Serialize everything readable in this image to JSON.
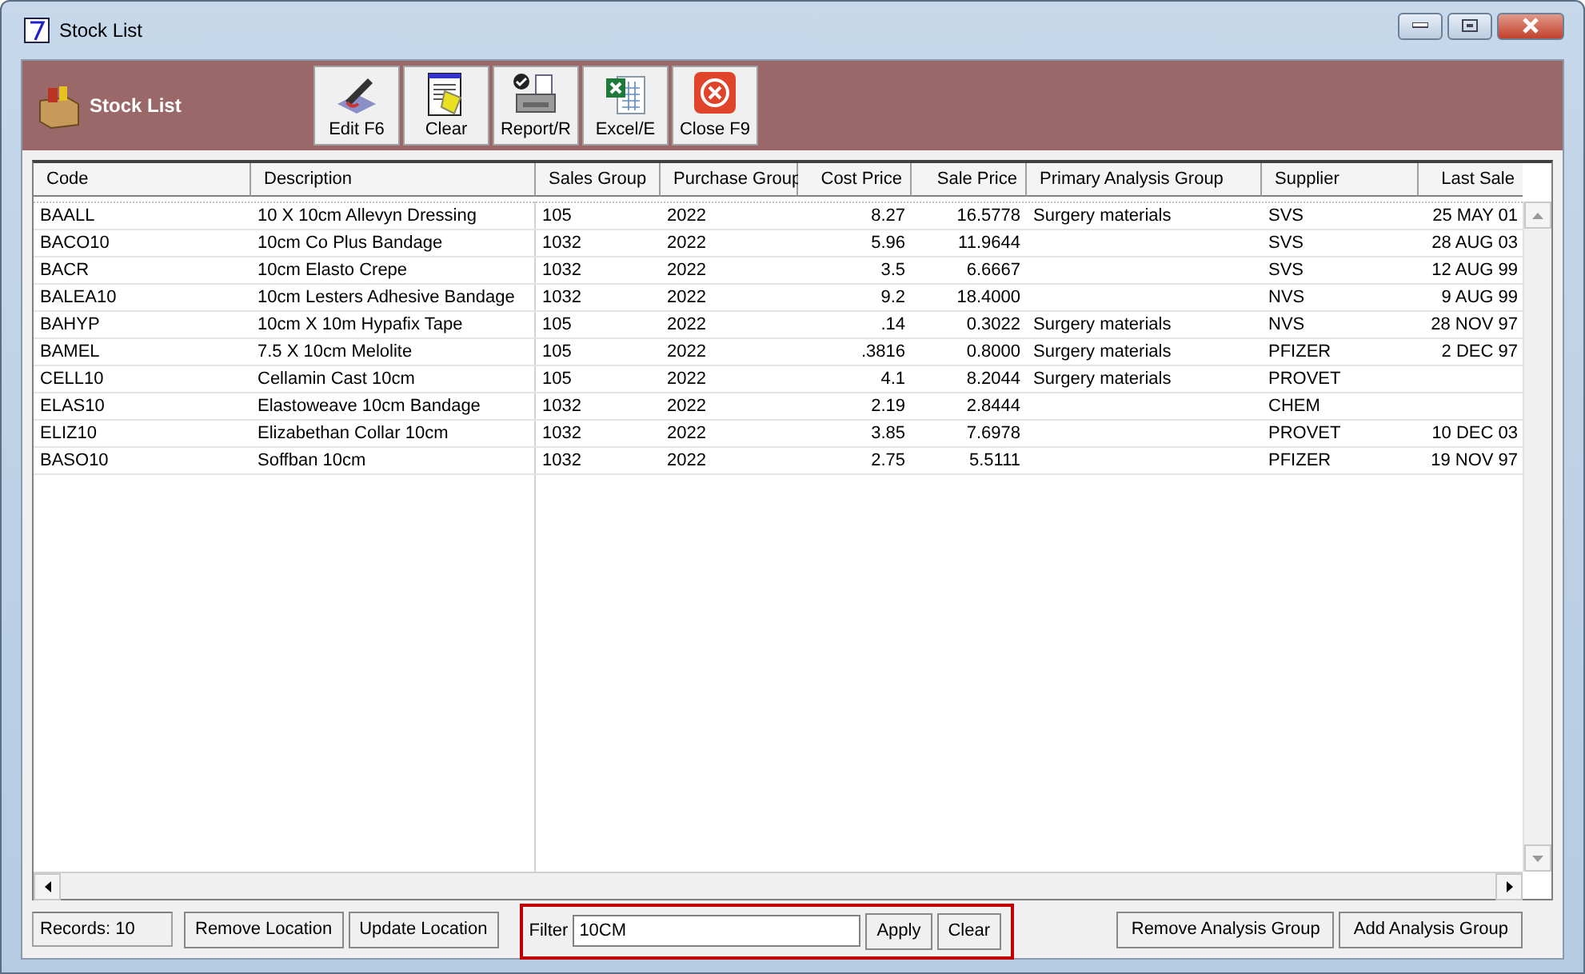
{
  "window": {
    "title": "Stock List"
  },
  "header": {
    "title": "Stock List"
  },
  "toolbar": [
    {
      "label": "Edit F6",
      "kind": "edit"
    },
    {
      "label": "Clear",
      "kind": "clear"
    },
    {
      "label": "Report/R",
      "kind": "report"
    },
    {
      "label": "Excel/E",
      "kind": "excel"
    },
    {
      "label": "Close F9",
      "kind": "close"
    }
  ],
  "table": {
    "columns": [
      {
        "label": "Code",
        "kind": "text"
      },
      {
        "label": "Description",
        "kind": "text"
      },
      {
        "label": "Sales Group",
        "kind": "text"
      },
      {
        "label": "Purchase Group",
        "kind": "text"
      },
      {
        "label": "Cost Price",
        "kind": "number"
      },
      {
        "label": "Sale Price",
        "kind": "number"
      },
      {
        "label": "Primary Analysis Group",
        "kind": "text"
      },
      {
        "label": "Supplier",
        "kind": "text"
      },
      {
        "label": "Last Sale",
        "kind": "number"
      }
    ],
    "rows": [
      [
        "BAALL",
        "10 X 10cm Allevyn Dressing",
        "105",
        "2022",
        "8.27",
        "16.5778",
        "Surgery materials",
        "SVS",
        "25 MAY 01"
      ],
      [
        "BACO10",
        "10cm Co Plus Bandage",
        "1032",
        "2022",
        "5.96",
        "11.9644",
        "",
        "SVS",
        "28 AUG 03"
      ],
      [
        "BACR",
        "10cm Elasto Crepe",
        "1032",
        "2022",
        "3.5",
        "6.6667",
        "",
        "SVS",
        "12 AUG 99"
      ],
      [
        "BALEA10",
        "10cm Lesters Adhesive Bandage",
        "1032",
        "2022",
        "9.2",
        "18.4000",
        "",
        "NVS",
        "9 AUG 99"
      ],
      [
        "BAHYP",
        "10cm X 10m Hypafix Tape",
        "105",
        "2022",
        ".14",
        "0.3022",
        "Surgery materials",
        "NVS",
        "28 NOV 97"
      ],
      [
        "BAMEL",
        "7.5 X 10cm Melolite",
        "105",
        "2022",
        ".3816",
        "0.8000",
        "Surgery materials",
        "PFIZER",
        "2 DEC 97"
      ],
      [
        "CELL10",
        "Cellamin Cast 10cm",
        "105",
        "2022",
        "4.1",
        "8.2044",
        "Surgery materials",
        "PROVET",
        ""
      ],
      [
        "ELAS10",
        "Elastoweave 10cm Bandage",
        "1032",
        "2022",
        "2.19",
        "2.8444",
        "",
        "CHEM",
        ""
      ],
      [
        "ELIZ10",
        "Elizabethan Collar 10cm",
        "1032",
        "2022",
        "3.85",
        "7.6978",
        "",
        "PROVET",
        "10 DEC 03"
      ],
      [
        "BASO10",
        "Soffban 10cm",
        "1032",
        "2022",
        "2.75",
        "5.5111",
        "",
        "PFIZER",
        "19 NOV 97"
      ]
    ]
  },
  "footer": {
    "records": "Records: 10",
    "location_buttons": [
      "Remove Location",
      "Update Location"
    ],
    "filter": {
      "label": "Filter",
      "value": "10CM",
      "buttons": [
        "Apply",
        "Clear"
      ]
    },
    "analysis_buttons": [
      "Remove Analysis Group",
      "Add Analysis Group"
    ]
  }
}
